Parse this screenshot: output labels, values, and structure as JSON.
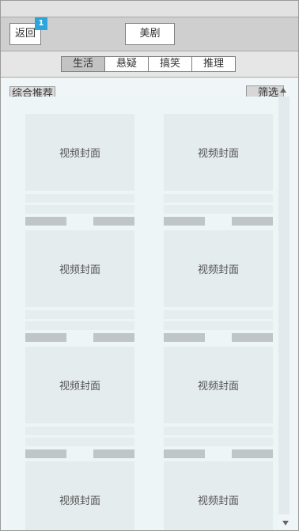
{
  "header": {
    "back_label": "返回",
    "badge_count": "1",
    "title": "美剧"
  },
  "tabs": [
    {
      "label": "生活",
      "active": true
    },
    {
      "label": "悬疑",
      "active": false
    },
    {
      "label": "搞笑",
      "active": false
    },
    {
      "label": "推理",
      "active": false
    }
  ],
  "content": {
    "section_label": "综合推荐",
    "filter_label": "筛选"
  },
  "videos": [
    {
      "cover_label": "视频封面"
    },
    {
      "cover_label": "视频封面"
    },
    {
      "cover_label": "视频封面"
    },
    {
      "cover_label": "视频封面"
    },
    {
      "cover_label": "视频封面"
    },
    {
      "cover_label": "视频封面"
    },
    {
      "cover_label": "视频封面"
    },
    {
      "cover_label": "视频封面"
    }
  ],
  "colors": {
    "badge": "#2aa5de",
    "active_tab": "#c3c3c3",
    "content_bg": "#f0f6f8"
  },
  "icons": [
    "scroll-up-arrow-icon",
    "scroll-down-arrow-icon"
  ]
}
